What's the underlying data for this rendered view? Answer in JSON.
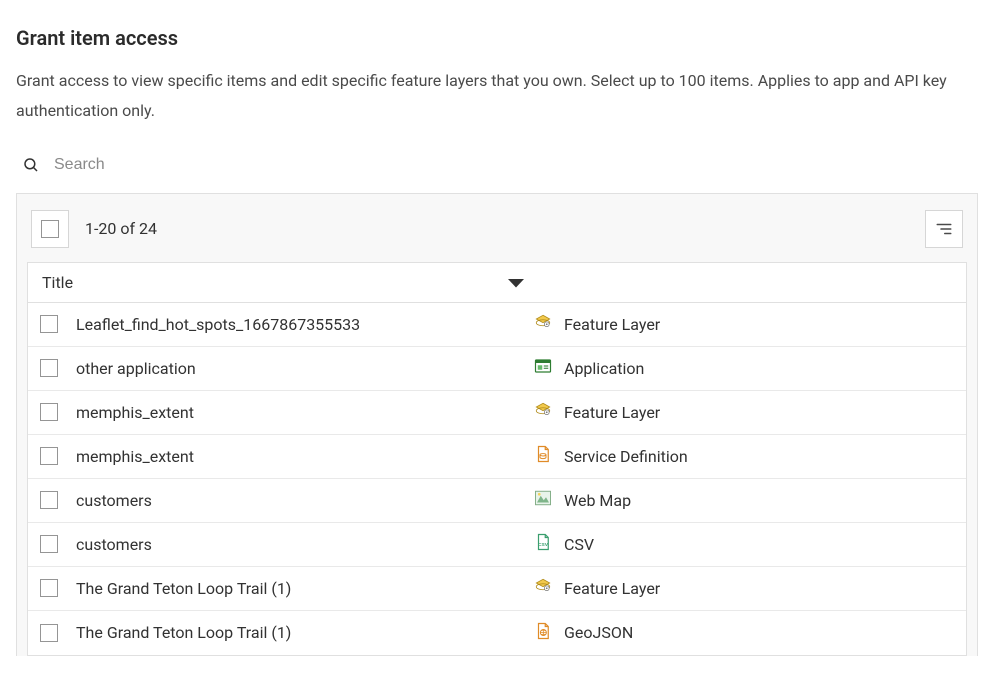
{
  "heading": "Grant item access",
  "description": "Grant access to view specific items and edit specific feature layers that you own. Select up to 100 items. Applies to app and API key authentication only.",
  "search": {
    "placeholder": "Search"
  },
  "toolbar": {
    "count": "1-20 of 24"
  },
  "table": {
    "header_title": "Title",
    "rows": [
      {
        "title": "Leaflet_find_hot_spots_1667867355533",
        "type": "Feature Layer",
        "icon": "feature-layer"
      },
      {
        "title": "other application",
        "type": "Application",
        "icon": "application"
      },
      {
        "title": "memphis_extent",
        "type": "Feature Layer",
        "icon": "feature-layer"
      },
      {
        "title": "memphis_extent",
        "type": "Service Definition",
        "icon": "service-definition"
      },
      {
        "title": "customers",
        "type": "Web Map",
        "icon": "web-map"
      },
      {
        "title": "customers",
        "type": "CSV",
        "icon": "csv"
      },
      {
        "title": "The Grand Teton Loop Trail (1)",
        "type": "Feature Layer",
        "icon": "feature-layer"
      },
      {
        "title": "The Grand Teton Loop Trail (1)",
        "type": "GeoJSON",
        "icon": "geojson"
      }
    ]
  }
}
